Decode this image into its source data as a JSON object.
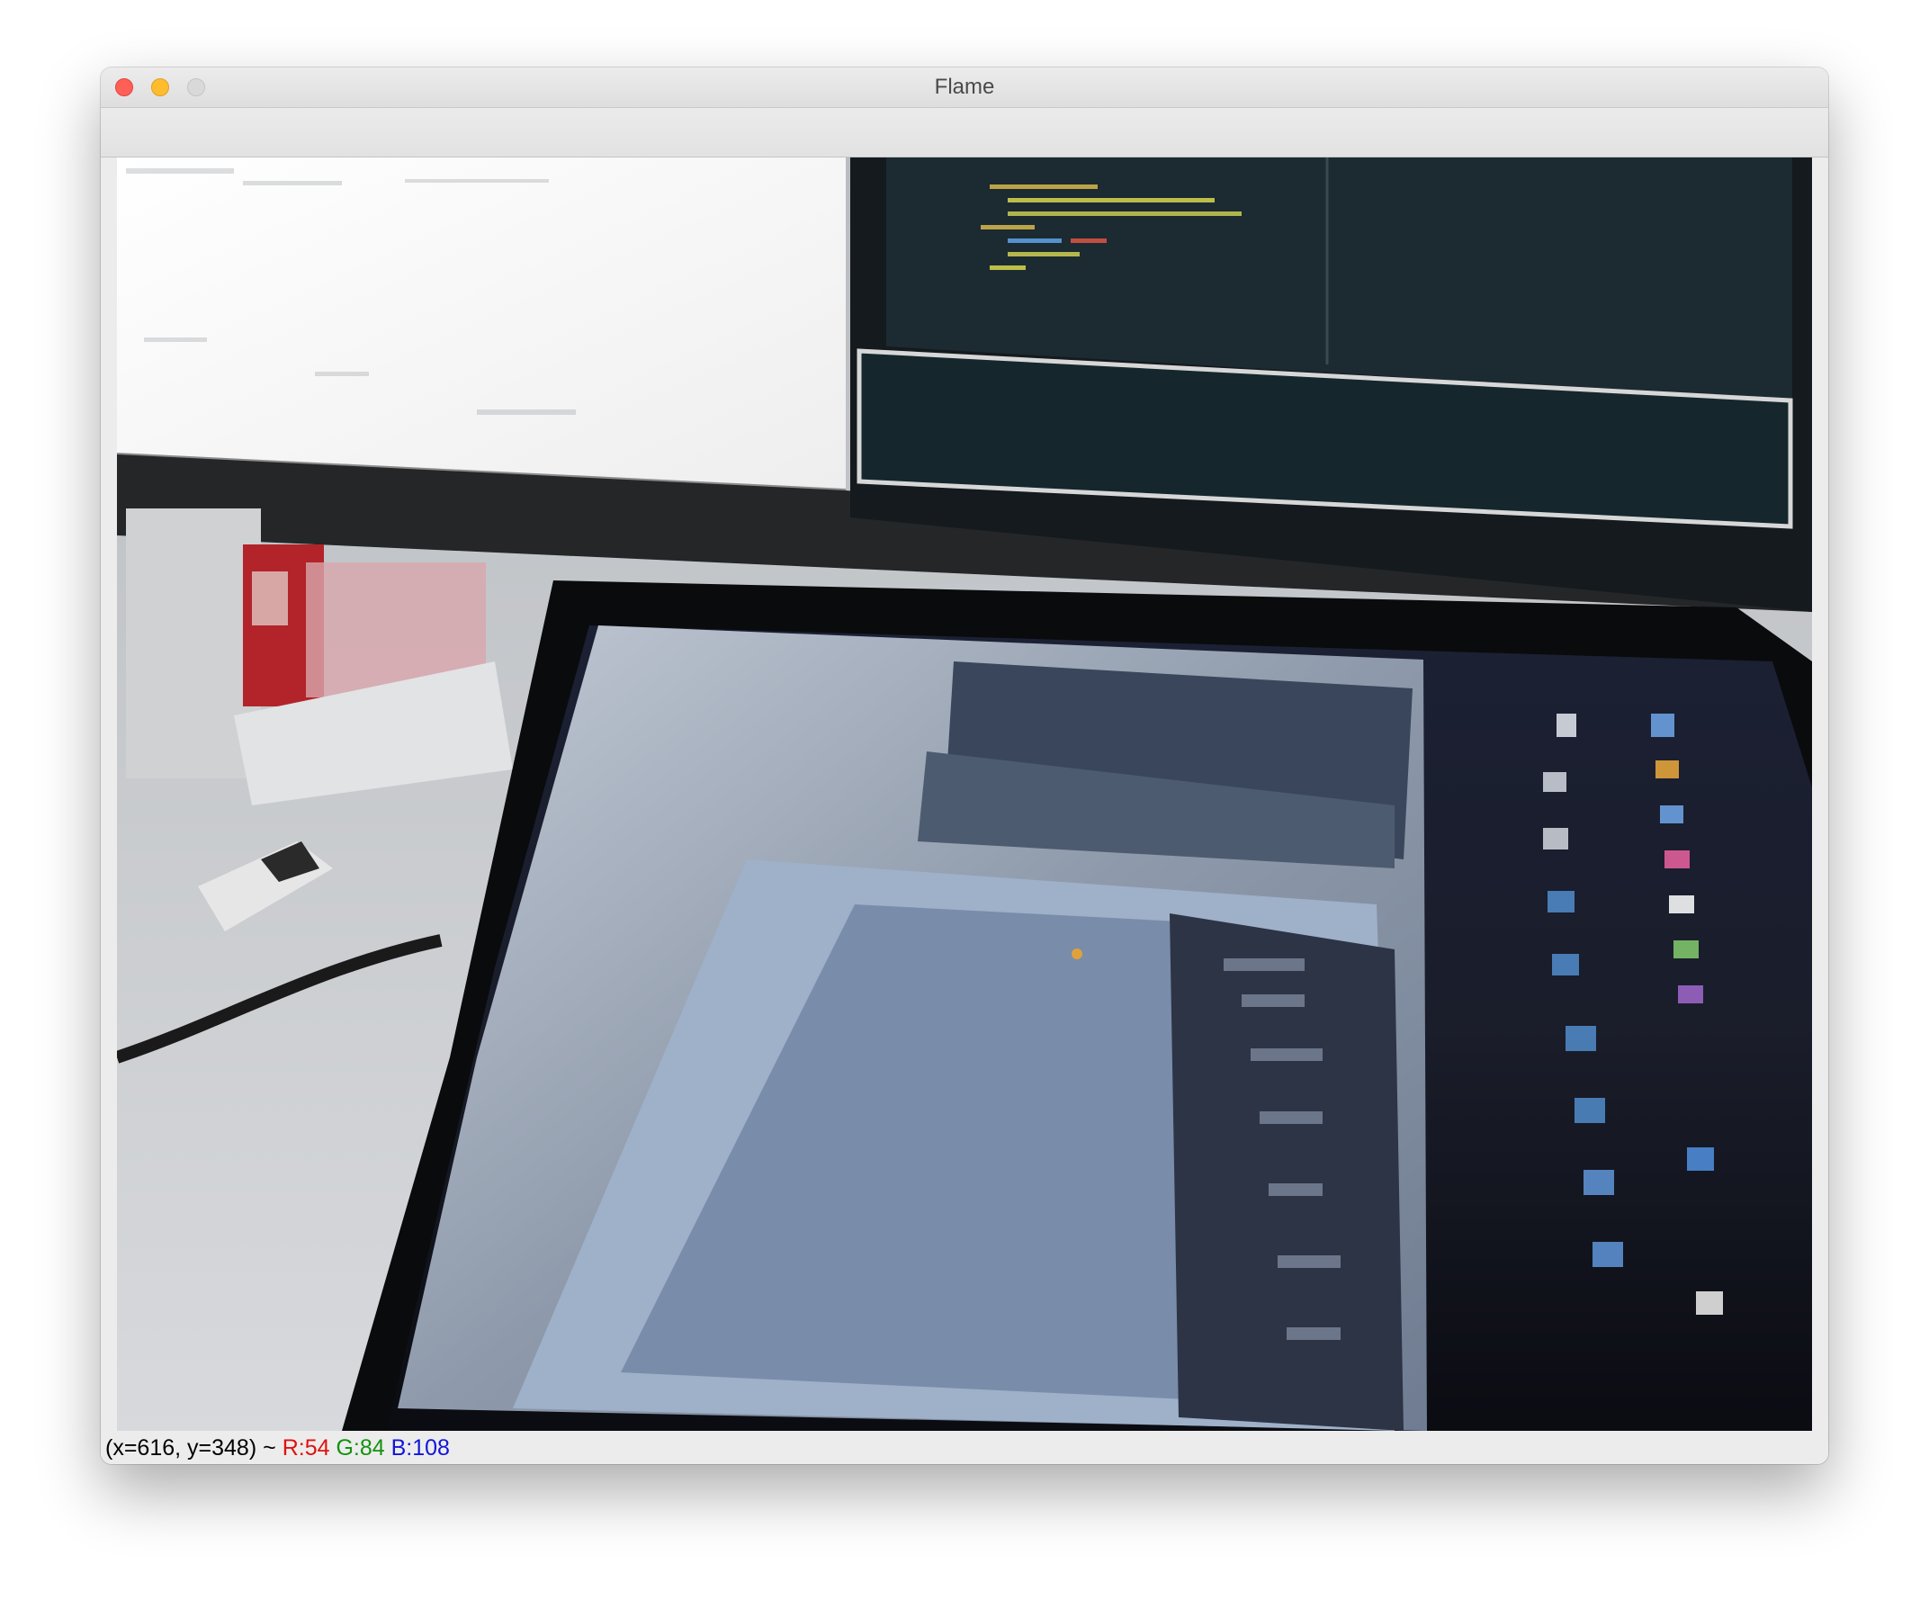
{
  "window": {
    "title": "Flame"
  },
  "statusbar": {
    "coords": "(x=616, y=348)",
    "separator": "~",
    "r_label": "R:54",
    "g_label": "G:84",
    "b_label": "B:108",
    "colors": {
      "r": "#e0120c",
      "g": "#14920f",
      "b": "#1216d8"
    }
  },
  "icons": [
    "close-icon",
    "minimize-icon",
    "zoom-icon"
  ]
}
